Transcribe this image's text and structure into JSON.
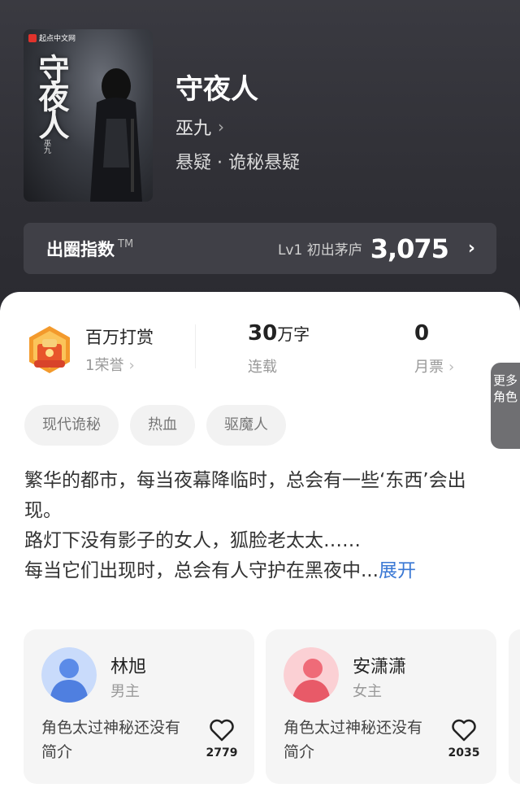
{
  "book": {
    "title": "守夜人",
    "author": "巫九",
    "genre": "悬疑 · 诡秘悬疑",
    "cover": {
      "publisher": "起点中文网",
      "title_text": "守夜人",
      "author_text": "巫九"
    }
  },
  "index": {
    "label": "出圈指数",
    "tm": "TM",
    "level": "Lv1 初出茅庐",
    "value": "3,075"
  },
  "stats": {
    "reward": {
      "title": "百万打赏",
      "sub": "1荣誉"
    },
    "words": {
      "value": "30",
      "unit": "万字",
      "label": "连载"
    },
    "votes": {
      "value": "0",
      "label": "月票"
    }
  },
  "tags": [
    "现代诡秘",
    "热血",
    "驱魔人"
  ],
  "description": {
    "line1": "繁华的都市，每当夜幕降临时，总会有一些‘东西’会出现。",
    "line2": "路灯下没有影子的女人，狐脸老太太……",
    "line3": "每当它们出现时，总会有人守护在黑夜中...",
    "expand": "展开"
  },
  "characters": [
    {
      "name": "林旭",
      "role": "男主",
      "desc": "角色太过神秘还没有简介",
      "likes": "2779",
      "avatar_color": "#5b8be8"
    },
    {
      "name": "安潇潇",
      "role": "女主",
      "desc": "角色太过神秘还没有简介",
      "likes": "2035",
      "avatar_color": "#ef6b78"
    }
  ],
  "more_roles": "更多角色",
  "colors": {
    "link": "#3a78d4",
    "hero_bg": "#2f2f35"
  }
}
